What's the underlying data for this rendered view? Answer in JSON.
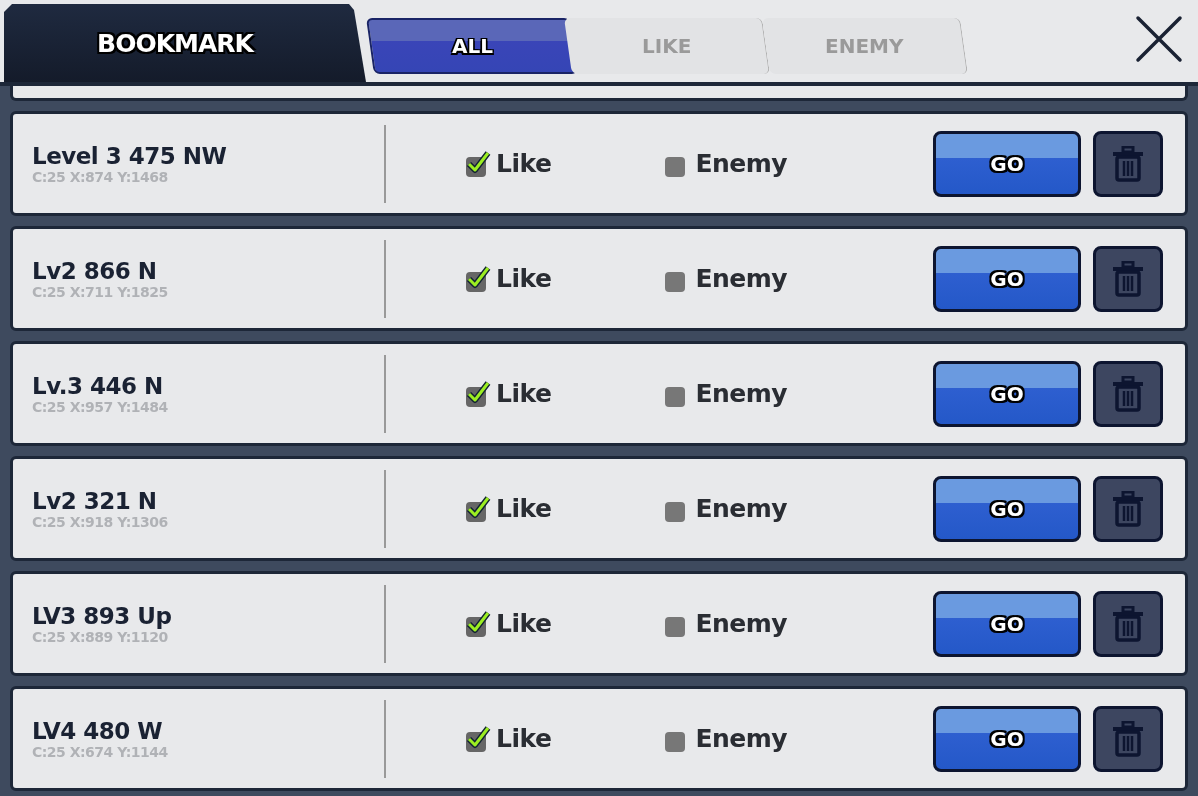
{
  "header": {
    "title": "BOOKMARK"
  },
  "tabs": [
    {
      "label": "ALL",
      "selected": true
    },
    {
      "label": "LIKE",
      "selected": false
    },
    {
      "label": "ENEMY",
      "selected": false
    }
  ],
  "bookmarks": [
    {
      "name": "Level 3 475 NW",
      "coords": "C:25 X:874 Y:1468",
      "like": {
        "label": "Like",
        "checked": true
      },
      "enemy": {
        "label": "Enemy",
        "checked": false
      },
      "go": "GO"
    },
    {
      "name": "Lv2 866 N",
      "coords": "C:25 X:711 Y:1825",
      "like": {
        "label": "Like",
        "checked": true
      },
      "enemy": {
        "label": "Enemy",
        "checked": false
      },
      "go": "GO"
    },
    {
      "name": "Lv.3 446 N",
      "coords": "C:25 X:957 Y:1484",
      "like": {
        "label": "Like",
        "checked": true
      },
      "enemy": {
        "label": "Enemy",
        "checked": false
      },
      "go": "GO"
    },
    {
      "name": "Lv2 321 N",
      "coords": "C:25 X:918 Y:1306",
      "like": {
        "label": "Like",
        "checked": true
      },
      "enemy": {
        "label": "Enemy",
        "checked": false
      },
      "go": "GO"
    },
    {
      "name": "LV3 893 Up",
      "coords": "C:25 X:889 Y:1120",
      "like": {
        "label": "Like",
        "checked": true
      },
      "enemy": {
        "label": "Enemy",
        "checked": false
      },
      "go": "GO"
    },
    {
      "name": "LV4 480 W",
      "coords": "C:25 X:674 Y:1144",
      "like": {
        "label": "Like",
        "checked": true
      },
      "enemy": {
        "label": "Enemy",
        "checked": false
      },
      "go": "GO"
    }
  ]
}
